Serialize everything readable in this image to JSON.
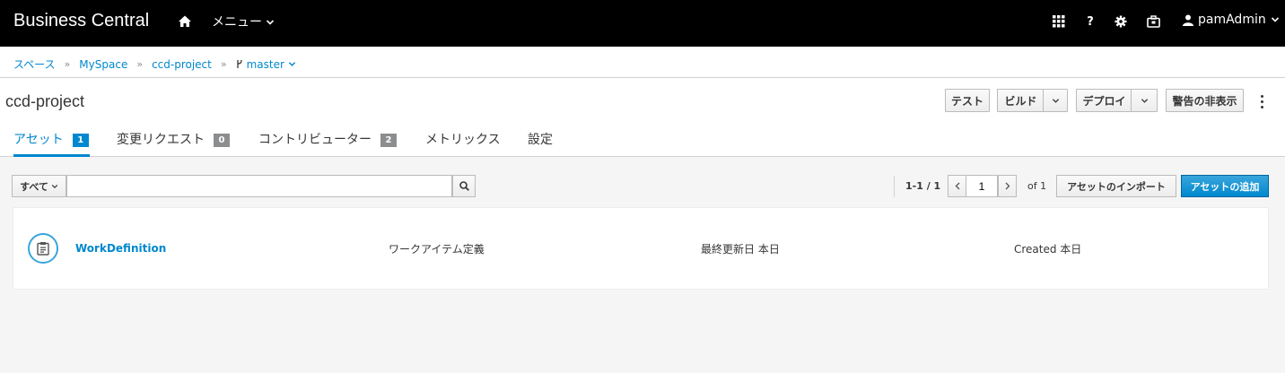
{
  "header": {
    "brand": "Business Central",
    "menu_label": "メニュー",
    "user": "pamAdmin",
    "icons": [
      "home-icon",
      "apps-grid-icon",
      "help-icon",
      "gear-icon",
      "briefcase-icon",
      "user-icon"
    ]
  },
  "breadcrumb": {
    "items": [
      "スペース",
      "MySpace",
      "ccd-project"
    ],
    "branch": "master"
  },
  "project": {
    "title": "ccd-project",
    "buttons": {
      "test": "テスト",
      "build": "ビルド",
      "deploy": "デプロイ",
      "hide_alerts": "警告の非表示"
    }
  },
  "tabs": [
    {
      "label": "アセット",
      "count": "1",
      "active": true
    },
    {
      "label": "変更リクエスト",
      "count": "0"
    },
    {
      "label": "コントリビューター",
      "count": "2"
    },
    {
      "label": "メトリックス"
    },
    {
      "label": "設定"
    }
  ],
  "toolbar": {
    "filter": "すべて",
    "search_value": "",
    "range": "1-1 / 1",
    "page": "1",
    "of": "of 1",
    "import_label": "アセットのインポート",
    "add_label": "アセットの追加"
  },
  "assets": [
    {
      "name": "WorkDefinition",
      "type": "ワークアイテム定義",
      "last_modified": "最終更新日 本日",
      "created": "Created 本日"
    }
  ],
  "colors": {
    "accent": "#0088ce",
    "navbar": "#000000",
    "badge_inactive": "#8b8d8f"
  }
}
